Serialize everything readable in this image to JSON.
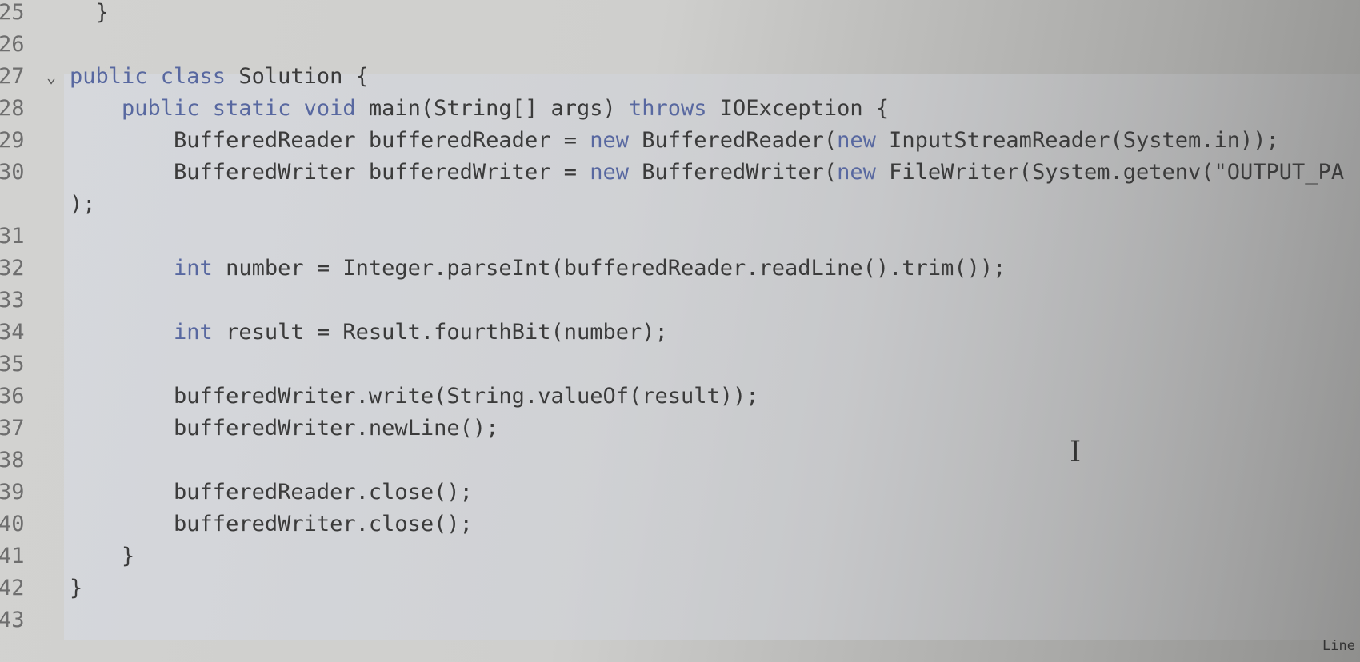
{
  "editor": {
    "lines": [
      {
        "num": "25",
        "fold": "",
        "tokens": [
          {
            "t": "  }",
            "k": "plain"
          }
        ]
      },
      {
        "num": "26",
        "fold": "",
        "tokens": []
      },
      {
        "num": "27",
        "fold": "⌄",
        "tokens": [
          {
            "t": "public class",
            "k": "kw"
          },
          {
            "t": " Solution {",
            "k": "plain"
          }
        ]
      },
      {
        "num": "28",
        "fold": "",
        "tokens": [
          {
            "t": "    public static void",
            "k": "kw"
          },
          {
            "t": " main(String[] args) ",
            "k": "plain"
          },
          {
            "t": "throws",
            "k": "kw"
          },
          {
            "t": " IOException {",
            "k": "plain"
          }
        ]
      },
      {
        "num": "29",
        "fold": "",
        "tokens": [
          {
            "t": "        BufferedReader bufferedReader = ",
            "k": "plain"
          },
          {
            "t": "new",
            "k": "kw"
          },
          {
            "t": " BufferedReader(",
            "k": "plain"
          },
          {
            "t": "new",
            "k": "kw"
          },
          {
            "t": " InputStreamReader(System.in));",
            "k": "plain"
          }
        ]
      },
      {
        "num": "30",
        "fold": "",
        "tokens": [
          {
            "t": "        BufferedWriter bufferedWriter = ",
            "k": "plain"
          },
          {
            "t": "new",
            "k": "kw"
          },
          {
            "t": " BufferedWriter(",
            "k": "plain"
          },
          {
            "t": "new",
            "k": "kw"
          },
          {
            "t": " FileWriter(System.getenv(\"OUTPUT_PA",
            "k": "plain"
          }
        ]
      },
      {
        "num": "",
        "fold": "",
        "tokens": [
          {
            "t": ");",
            "k": "plain"
          }
        ]
      },
      {
        "num": "31",
        "fold": "",
        "tokens": []
      },
      {
        "num": "32",
        "fold": "",
        "tokens": [
          {
            "t": "        int",
            "k": "kw"
          },
          {
            "t": " number = Integer.parseInt(bufferedReader.readLine().trim());",
            "k": "plain"
          }
        ]
      },
      {
        "num": "33",
        "fold": "",
        "tokens": []
      },
      {
        "num": "34",
        "fold": "",
        "tokens": [
          {
            "t": "        int",
            "k": "kw"
          },
          {
            "t": " result = Result.fourthBit(number);",
            "k": "plain"
          }
        ]
      },
      {
        "num": "35",
        "fold": "",
        "tokens": []
      },
      {
        "num": "36",
        "fold": "",
        "tokens": [
          {
            "t": "        bufferedWriter.write(String.valueOf(result));",
            "k": "plain"
          }
        ]
      },
      {
        "num": "37",
        "fold": "",
        "tokens": [
          {
            "t": "        bufferedWriter.newLine();",
            "k": "plain"
          }
        ]
      },
      {
        "num": "38",
        "fold": "",
        "tokens": []
      },
      {
        "num": "39",
        "fold": "",
        "tokens": [
          {
            "t": "        bufferedReader.close();",
            "k": "plain"
          }
        ]
      },
      {
        "num": "40",
        "fold": "",
        "tokens": [
          {
            "t": "        bufferedWriter.close();",
            "k": "plain"
          }
        ]
      },
      {
        "num": "41",
        "fold": "",
        "tokens": [
          {
            "t": "    }",
            "k": "plain"
          }
        ]
      },
      {
        "num": "42",
        "fold": "",
        "tokens": [
          {
            "t": "}",
            "k": "plain"
          }
        ]
      },
      {
        "num": "43",
        "fold": "",
        "tokens": []
      }
    ]
  },
  "status": {
    "position_label": "Line"
  },
  "colors": {
    "keyword": "#5868a0",
    "text": "#3b3b3b",
    "line_number": "#6e6e6e"
  }
}
